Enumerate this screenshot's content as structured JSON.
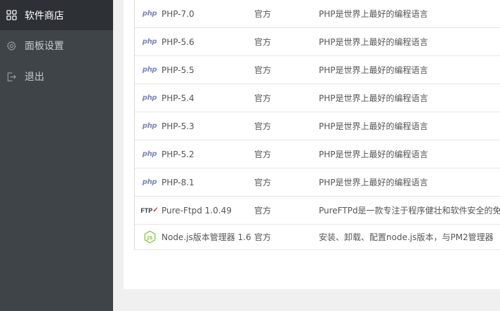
{
  "sidebar": {
    "items": [
      {
        "label": "软件商店",
        "icon": "grid-icon",
        "active": true
      },
      {
        "label": "面板设置",
        "icon": "gear-icon",
        "active": false
      },
      {
        "label": "退出",
        "icon": "logout-icon",
        "active": false
      }
    ]
  },
  "table": {
    "rows": [
      {
        "logo": "php",
        "name": "PHP-7.0",
        "type": "官方",
        "desc": "PHP是世界上最好的编程语言"
      },
      {
        "logo": "php",
        "name": "PHP-5.6",
        "type": "官方",
        "desc": "PHP是世界上最好的编程语言"
      },
      {
        "logo": "php",
        "name": "PHP-5.5",
        "type": "官方",
        "desc": "PHP是世界上最好的编程语言"
      },
      {
        "logo": "php",
        "name": "PHP-5.4",
        "type": "官方",
        "desc": "PHP是世界上最好的编程语言"
      },
      {
        "logo": "php",
        "name": "PHP-5.3",
        "type": "官方",
        "desc": "PHP是世界上最好的编程语言"
      },
      {
        "logo": "php",
        "name": "PHP-5.2",
        "type": "官方",
        "desc": "PHP是世界上最好的编程语言"
      },
      {
        "logo": "php",
        "name": "PHP-8.1",
        "type": "官方",
        "desc": "PHP是世界上最好的编程语言"
      },
      {
        "logo": "ftp",
        "name": "Pure-Ftpd 1.0.49",
        "type": "官方",
        "desc": "PureFTPd是一款专注于程序健壮和软件安全的免"
      },
      {
        "logo": "node",
        "name": "Node.js版本管理器 1.6",
        "type": "官方",
        "desc": "安装、卸载、配置node.js版本，与PM2管理器"
      }
    ],
    "logo_text": {
      "php": "php",
      "ftp": "FTP"
    }
  },
  "colors": {
    "sidebar_bg": "#3f4449",
    "sidebar_active": "#2d3035",
    "node_green": "#8cc84b",
    "php_purple": "#7a86b8"
  }
}
